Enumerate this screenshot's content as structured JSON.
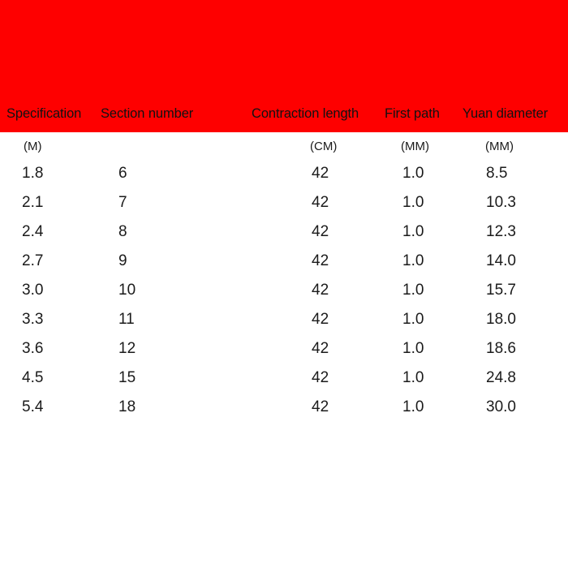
{
  "theme": {
    "band_color": "#fe0000",
    "background_color": "#ffffff",
    "text_color": "#1b1b1b"
  },
  "table": {
    "headers": [
      {
        "label": "Specification",
        "unit": "(M)"
      },
      {
        "label": "Section number",
        "unit": ""
      },
      {
        "label": "Contraction length",
        "unit": "(CM)"
      },
      {
        "label": "First path",
        "unit": "(MM)"
      },
      {
        "label": "Yuan diameter",
        "unit": "(MM)"
      }
    ],
    "rows": [
      {
        "specification": "1.8",
        "section_number": "6",
        "contraction_length": "42",
        "first_path": "1.0",
        "yuan_diameter": "8.5"
      },
      {
        "specification": "2.1",
        "section_number": "7",
        "contraction_length": "42",
        "first_path": "1.0",
        "yuan_diameter": "10.3"
      },
      {
        "specification": "2.4",
        "section_number": "8",
        "contraction_length": "42",
        "first_path": "1.0",
        "yuan_diameter": "12.3"
      },
      {
        "specification": "2.7",
        "section_number": "9",
        "contraction_length": "42",
        "first_path": "1.0",
        "yuan_diameter": "14.0"
      },
      {
        "specification": "3.0",
        "section_number": "10",
        "contraction_length": "42",
        "first_path": "1.0",
        "yuan_diameter": "15.7"
      },
      {
        "specification": "3.3",
        "section_number": "11",
        "contraction_length": "42",
        "first_path": "1.0",
        "yuan_diameter": "18.0"
      },
      {
        "specification": "3.6",
        "section_number": "12",
        "contraction_length": "42",
        "first_path": "1.0",
        "yuan_diameter": "18.6"
      },
      {
        "specification": "4.5",
        "section_number": "15",
        "contraction_length": "42",
        "first_path": "1.0",
        "yuan_diameter": "24.8"
      },
      {
        "specification": "5.4",
        "section_number": "18",
        "contraction_length": "42",
        "first_path": "1.0",
        "yuan_diameter": "30.0"
      }
    ]
  }
}
